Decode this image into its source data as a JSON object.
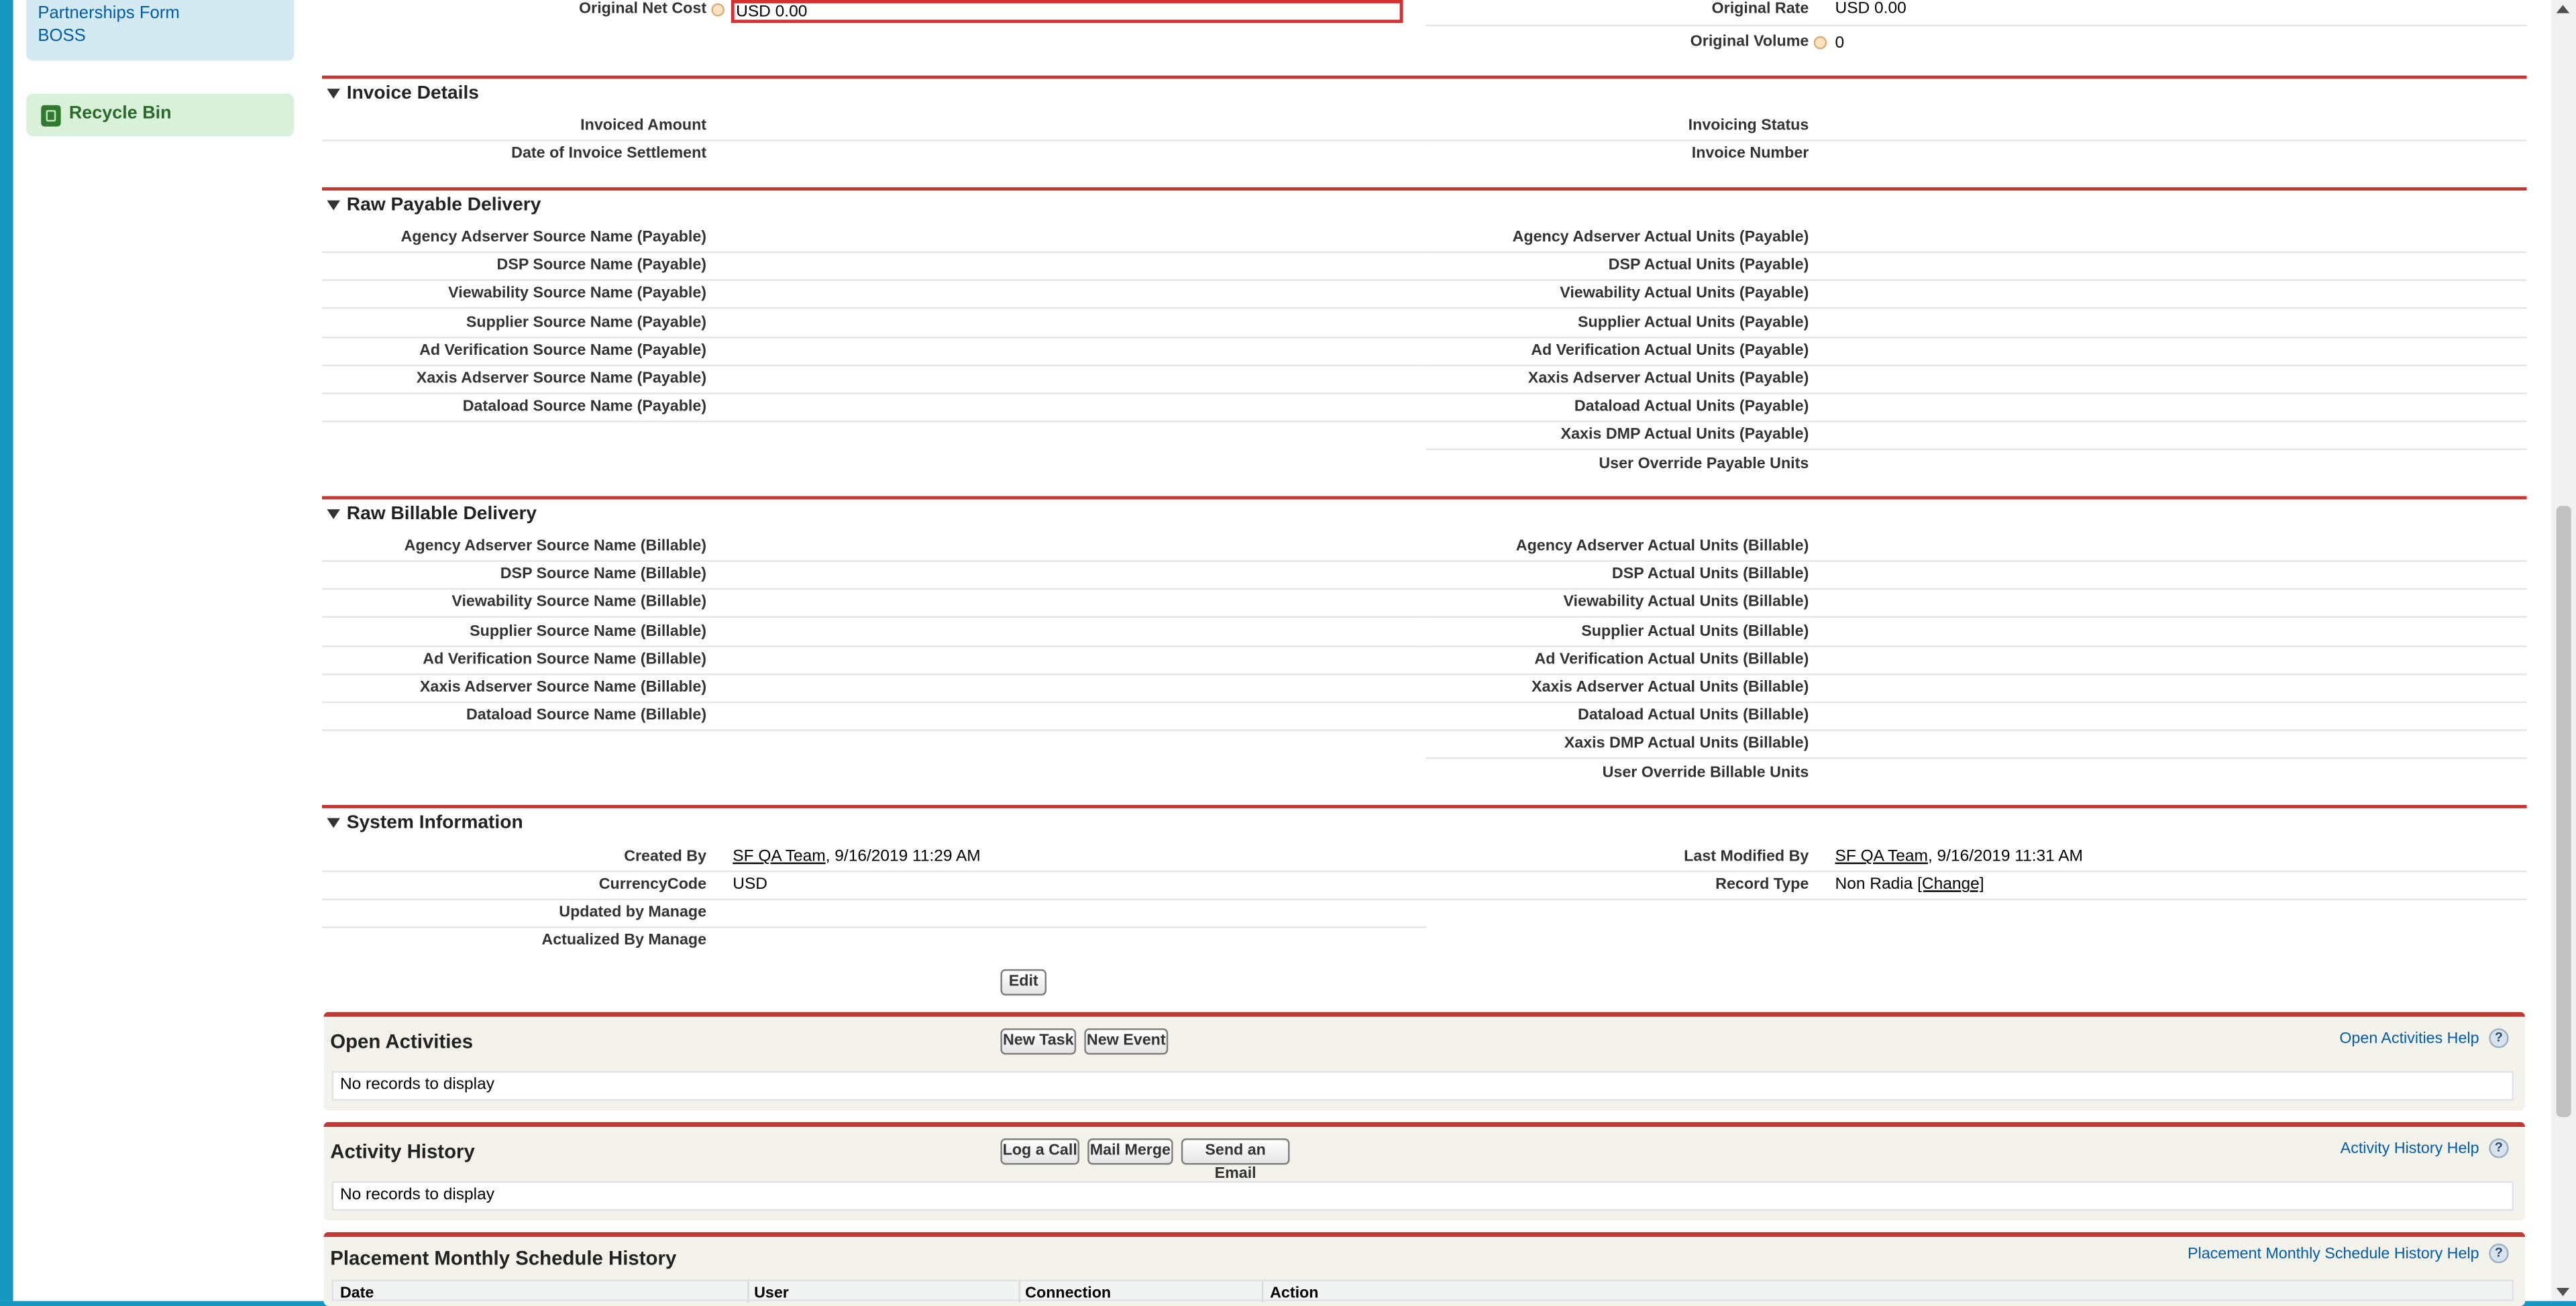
{
  "sidebar": {
    "links": [
      "Partnerships Form",
      "BOSS"
    ],
    "recycle_bin": "Recycle Bin"
  },
  "top_fields": {
    "original_net_cost_label": "Original Net Cost",
    "original_net_cost_value": "USD 0.00",
    "original_rate_label": "Original Rate",
    "original_rate_value": "USD 0.00",
    "original_volume_label": "Original Volume",
    "original_volume_value": "0"
  },
  "invoice": {
    "title": "Invoice Details",
    "left": [
      "Invoiced Amount",
      "Date of Invoice Settlement"
    ],
    "right": [
      "Invoicing Status",
      "Invoice Number"
    ]
  },
  "payable": {
    "title": "Raw Payable Delivery",
    "left": [
      "Agency Adserver Source Name (Payable)",
      "DSP Source Name (Payable)",
      "Viewability Source Name (Payable)",
      "Supplier Source Name (Payable)",
      "Ad Verification Source Name (Payable)",
      "Xaxis Adserver Source Name (Payable)",
      "Dataload Source Name (Payable)"
    ],
    "right": [
      "Agency Adserver Actual Units (Payable)",
      "DSP Actual Units (Payable)",
      "Viewability Actual Units (Payable)",
      "Supplier Actual Units (Payable)",
      "Ad Verification Actual Units (Payable)",
      "Xaxis Adserver Actual Units (Payable)",
      "Dataload Actual Units (Payable)",
      "Xaxis DMP Actual Units (Payable)",
      "User Override Payable Units"
    ]
  },
  "billable": {
    "title": "Raw Billable Delivery",
    "left": [
      "Agency Adserver Source Name (Billable)",
      "DSP Source Name (Billable)",
      "Viewability Source Name (Billable)",
      "Supplier Source Name (Billable)",
      "Ad Verification Source Name (Billable)",
      "Xaxis Adserver Source Name (Billable)",
      "Dataload Source Name (Billable)"
    ],
    "right": [
      "Agency Adserver Actual Units (Billable)",
      "DSP Actual Units (Billable)",
      "Viewability Actual Units (Billable)",
      "Supplier Actual Units (Billable)",
      "Ad Verification Actual Units (Billable)",
      "Xaxis Adserver Actual Units (Billable)",
      "Dataload Actual Units (Billable)",
      "Xaxis DMP Actual Units (Billable)",
      "User Override Billable Units"
    ]
  },
  "system": {
    "title": "System Information",
    "created_by_label": "Created By",
    "created_by_user": "SF QA Team",
    "created_by_date": ", 9/16/2019 11:29 AM",
    "currency_label": "CurrencyCode",
    "currency_value": "USD",
    "updated_label": "Updated by Manage",
    "actualized_label": "Actualized By Manage",
    "modified_label": "Last Modified By",
    "modified_user": "SF QA Team",
    "modified_date": ", 9/16/2019 11:31 AM",
    "record_type_label": "Record Type",
    "record_type_value": "Non Radia",
    "record_type_change": "[Change]",
    "edit_button": "Edit"
  },
  "open_activities": {
    "title": "Open Activities",
    "buttons": [
      "New Task",
      "New Event"
    ],
    "help": "Open Activities Help",
    "empty": "No records to display"
  },
  "activity_history": {
    "title": "Activity History",
    "buttons": [
      "Log a Call",
      "Mail Merge",
      "Send an Email"
    ],
    "help": "Activity History Help",
    "empty": "No records to display"
  },
  "schedule_history": {
    "title": "Placement Monthly Schedule History",
    "help": "Placement Monthly Schedule History Help",
    "columns": [
      "Date",
      "User",
      "Connection",
      "Action"
    ]
  },
  "colors": {
    "section_rule": "#c23934",
    "sidebar_bg": "#d4eaf3",
    "recycle_bg": "#d9f1d9",
    "page_frame": "#1797c0"
  },
  "icons": [
    "info-icon",
    "collapse-triangle-icon",
    "help-icon",
    "recycle-bin-icon"
  ]
}
